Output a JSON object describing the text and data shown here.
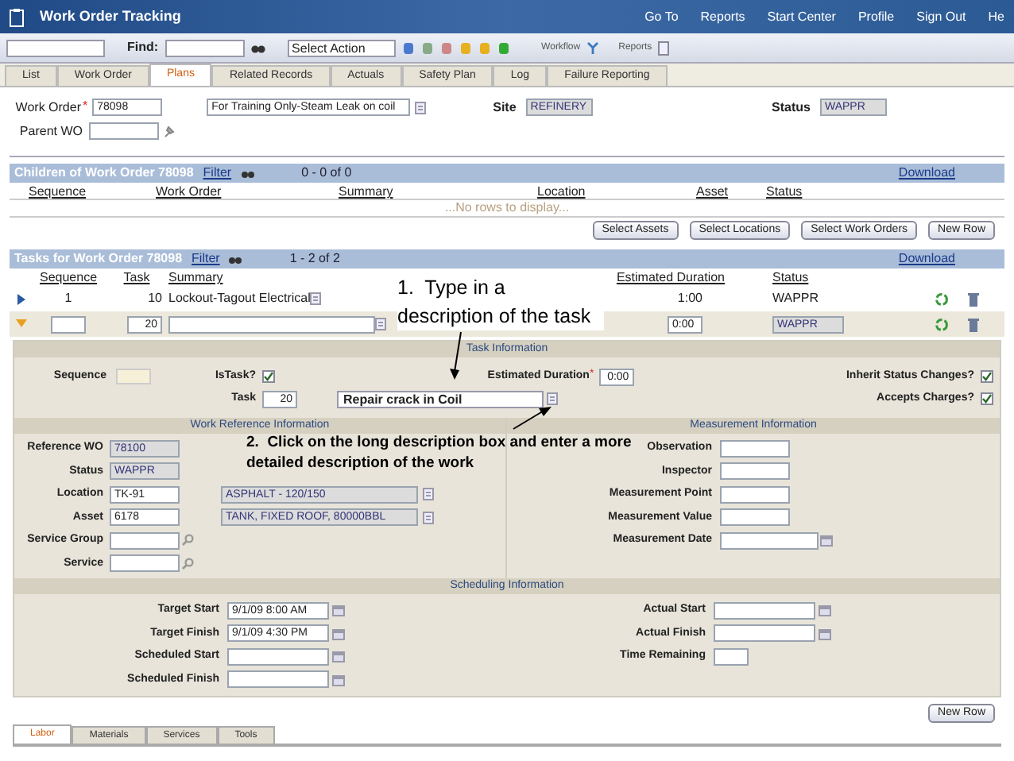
{
  "header": {
    "title": "Work Order Tracking",
    "links": [
      "Go To",
      "Reports",
      "Start Center",
      "Profile",
      "Sign Out",
      "He"
    ]
  },
  "toolbar": {
    "find_label": "Find:",
    "action_select": "Select Action",
    "workflow_label": "Workflow",
    "reports_label": "Reports"
  },
  "tabs": [
    {
      "label": "List",
      "selected": false
    },
    {
      "label": "Work Order",
      "selected": false
    },
    {
      "label": "Plans",
      "selected": true
    },
    {
      "label": "Related Records",
      "selected": false
    },
    {
      "label": "Actuals",
      "selected": false
    },
    {
      "label": "Safety Plan",
      "selected": false
    },
    {
      "label": "Log",
      "selected": false
    },
    {
      "label": "Failure Reporting",
      "selected": false
    }
  ],
  "work_order": {
    "label": "Work Order",
    "required_mark": "*",
    "value": "78098",
    "description": "For Training Only-Steam Leak on coil",
    "site_label": "Site",
    "site": "REFINERY",
    "status_label": "Status",
    "status": "WAPPR",
    "parent_label": "Parent WO"
  },
  "children": {
    "title": "Children of Work Order 78098",
    "filter": "Filter",
    "paging": "0 - 0 of 0",
    "download": "Download",
    "columns": [
      "Sequence",
      "Work Order",
      "Summary",
      "Location",
      "Asset",
      "Status"
    ],
    "empty": "...No rows to display...",
    "buttons": [
      "Select Assets",
      "Select Locations",
      "Select Work Orders",
      "New Row"
    ]
  },
  "tasks": {
    "title": "Tasks for Work Order 78098",
    "filter": "Filter",
    "paging": "1 - 2 of 2",
    "download": "Download",
    "columns": [
      "Sequence",
      "Task",
      "Summary",
      "Estimated Duration",
      "Status"
    ],
    "rows": [
      {
        "kind": "view",
        "expanded": false,
        "sequence": "1",
        "task": "10",
        "summary": "Lockout-Tagout Electrical",
        "duration": "1:00",
        "status": "WAPPR"
      },
      {
        "kind": "edit",
        "expanded": true,
        "task": "20",
        "duration": "0:00",
        "status": "WAPPR"
      }
    ]
  },
  "task_info": {
    "title": "Task Information",
    "sequence_label": "Sequence",
    "istask_label": "IsTask?",
    "istask_checked": true,
    "task_label": "Task",
    "task": "20",
    "description": "Repair crack in Coil",
    "duration_label": "Estimated Duration",
    "required_mark": "*",
    "duration": "0:00",
    "inherit_label": "Inherit Status Changes?",
    "inherit_checked": true,
    "accepts_label": "Accepts Charges?",
    "accepts_checked": true
  },
  "work_reference": {
    "title": "Work Reference Information",
    "fields": [
      {
        "label": "Reference WO",
        "value": "78100",
        "readonly": true,
        "kind": "lookup"
      },
      {
        "label": "Status",
        "value": "WAPPR",
        "readonly": true,
        "kind": "plain"
      },
      {
        "label": "Location",
        "value": "TK-91",
        "readonly": false,
        "kind": "lookup",
        "description": "ASPHALT - 120/150"
      },
      {
        "label": "Asset",
        "value": "6178",
        "readonly": false,
        "kind": "lookup",
        "description": "TANK, FIXED ROOF, 80000BBL"
      },
      {
        "label": "Service Group",
        "readonly": false,
        "kind": "search"
      },
      {
        "label": "Service",
        "readonly": false,
        "kind": "search"
      }
    ]
  },
  "measurement": {
    "title": "Measurement Information",
    "fields": [
      {
        "label": "Observation",
        "kind": "plain"
      },
      {
        "label": "Inspector",
        "kind": "lookup"
      },
      {
        "label": "Measurement Point",
        "kind": "lookup"
      },
      {
        "label": "Measurement Value",
        "kind": "plain"
      },
      {
        "label": "Measurement Date",
        "kind": "date"
      }
    ]
  },
  "scheduling": {
    "title": "Scheduling Information",
    "left": [
      {
        "label": "Target Start",
        "value": "9/1/09 8:00 AM",
        "kind": "date"
      },
      {
        "label": "Target Finish",
        "value": "9/1/09 4:30 PM",
        "kind": "date"
      },
      {
        "label": "Scheduled Start",
        "kind": "date"
      },
      {
        "label": "Scheduled Finish",
        "kind": "date"
      }
    ],
    "right": [
      {
        "label": "Actual Start",
        "kind": "date"
      },
      {
        "label": "Actual Finish",
        "kind": "date"
      },
      {
        "label": "Time Remaining",
        "kind": "short"
      }
    ]
  },
  "new_row": "New Row",
  "bottom_tabs": [
    {
      "label": "Labor",
      "selected": true
    },
    {
      "label": "Materials",
      "selected": false
    },
    {
      "label": "Services",
      "selected": false
    },
    {
      "label": "Tools",
      "selected": false
    }
  ],
  "annotations": [
    "1.  Type in a description of the task",
    "2.  Click on the long description box and enter a more detailed description of the work"
  ]
}
